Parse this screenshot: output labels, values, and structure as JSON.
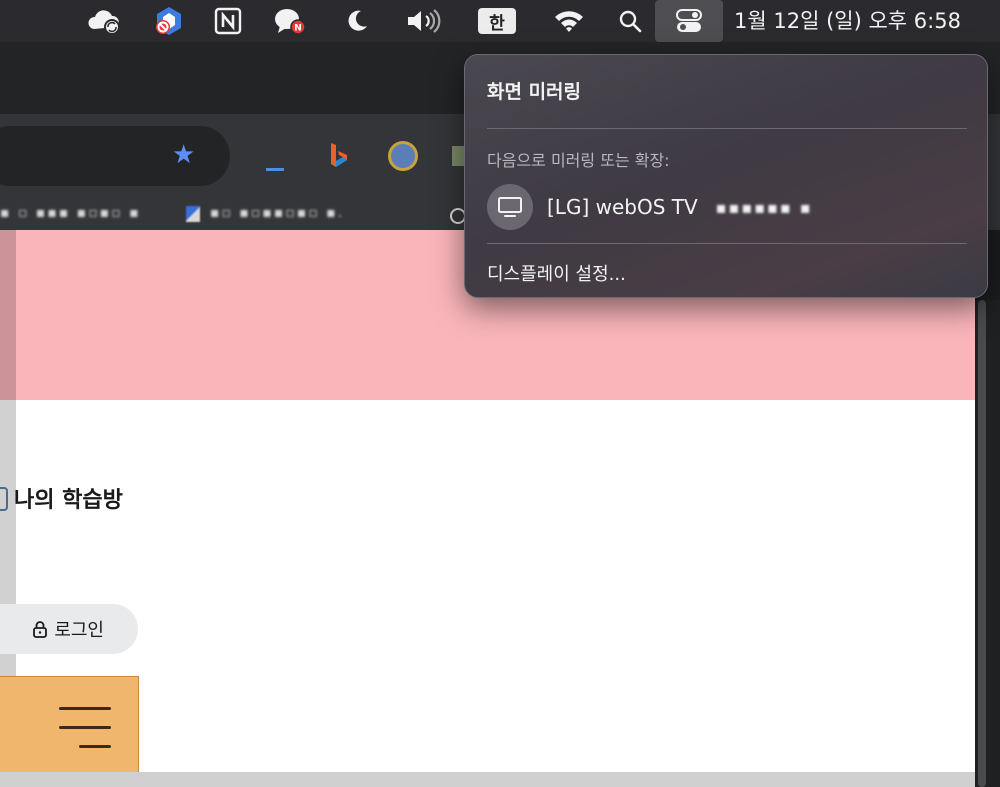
{
  "menubar": {
    "icons": [
      "icloud-sync-icon",
      "blocker-app-icon",
      "notion-icon",
      "chat-notification-icon",
      "moon-icon",
      "volume-icon",
      "input-method-icon",
      "wifi-icon",
      "search-icon",
      "control-center-icon"
    ],
    "input_method": "한",
    "clock": "1월 12일 (일) 오후 6:58"
  },
  "browser": {
    "bookmark_1": "▪ ▫ ▪▪▪ ▪▫▪▫ ▪",
    "bookmark_2": "▪▫ ▪▫▪▪▫▪▫ ▪.",
    "extensions": [
      "extension-underline-icon",
      "bing-icon",
      "extension-gear-icon"
    ]
  },
  "page": {
    "study_room": "나의 학습방",
    "login": "로그인"
  },
  "popup": {
    "title": "화면 미러링",
    "subtitle": "다음으로 미러링 또는 확장:",
    "device_name": "[LG] webOS TV",
    "device_serial": "▪▪▪▪▪▪ ▪",
    "display_settings": "디스플레이 설정..."
  },
  "colors": {
    "menubar_bg": "#2b2a2e",
    "page_banner": "#f9b5ba",
    "menu_button": "#f1b66e",
    "star": "#5b8ff7"
  }
}
